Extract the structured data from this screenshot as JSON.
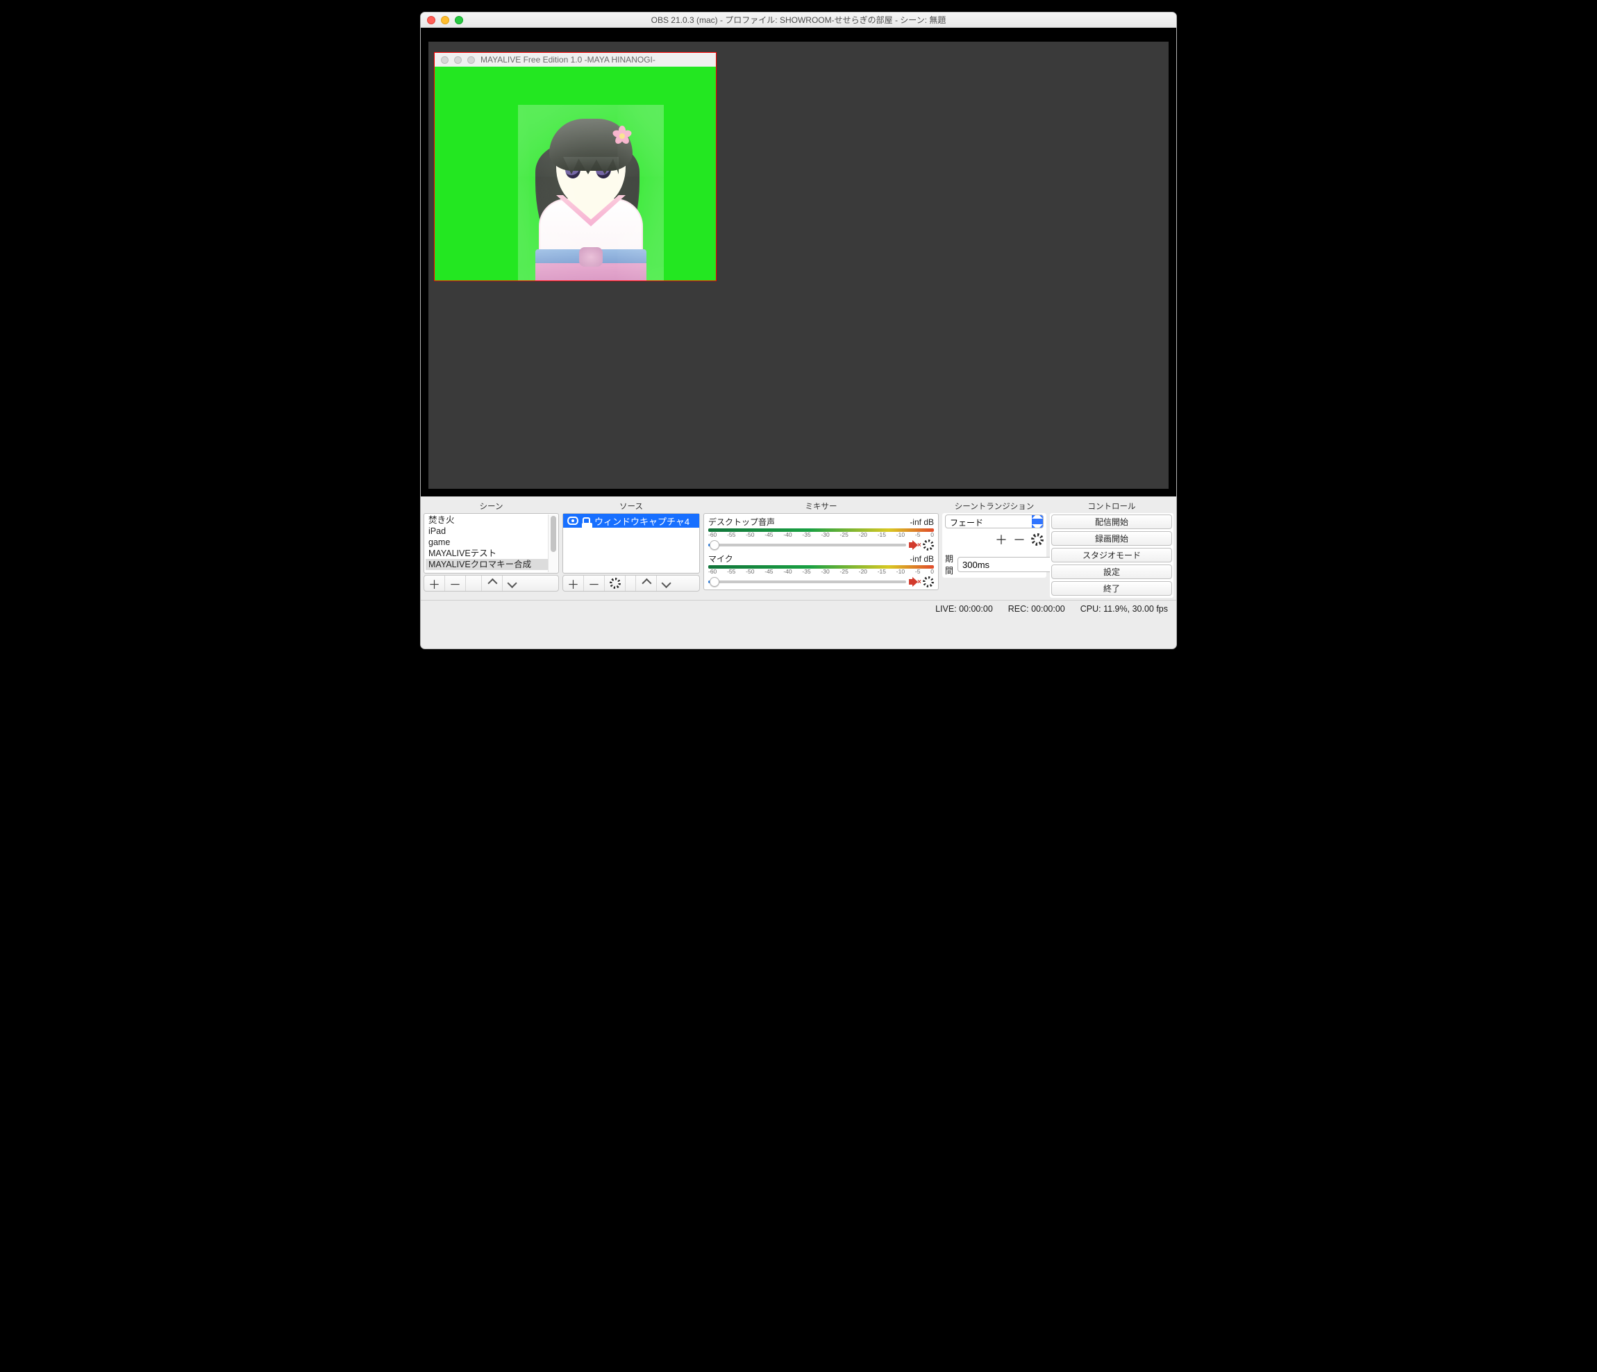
{
  "window": {
    "title": "OBS 21.0.3 (mac) - プロファイル: SHOWROOM-せせらぎの部屋 - シーン: 無題"
  },
  "preview_source": {
    "title": "MAYALIVE Free Edition 1.0 -MAYA HINANOGI-"
  },
  "panels": {
    "scenes": "シーン",
    "sources": "ソース",
    "mixer": "ミキサー",
    "transitions": "シーントランジション",
    "controls": "コントロール"
  },
  "scenes": {
    "items": [
      "焚き火",
      "iPad",
      "game",
      "MAYALIVEテスト",
      "MAYALIVEクロマキー合成"
    ],
    "selected_index": 4
  },
  "sources": {
    "items": [
      {
        "name": "ウィンドウキャプチャ4",
        "visible": true,
        "locked": true
      }
    ]
  },
  "mixer": {
    "ticks": [
      "-60",
      "-55",
      "-50",
      "-45",
      "-40",
      "-35",
      "-30",
      "-25",
      "-20",
      "-15",
      "-10",
      "-5",
      "0"
    ],
    "channels": [
      {
        "name": "デスクトップ音声",
        "level": "-inf dB",
        "muted": true
      },
      {
        "name": "マイク",
        "level": "-inf dB",
        "muted": true
      }
    ]
  },
  "transitions": {
    "selected": "フェード",
    "duration_label": "期間",
    "duration_value": "300ms"
  },
  "controls": {
    "buttons": [
      "配信開始",
      "録画開始",
      "スタジオモード",
      "設定",
      "終了"
    ]
  },
  "status": {
    "live": "LIVE: 00:00:00",
    "rec": "REC: 00:00:00",
    "cpu": "CPU: 11.9%, 30.00 fps"
  }
}
